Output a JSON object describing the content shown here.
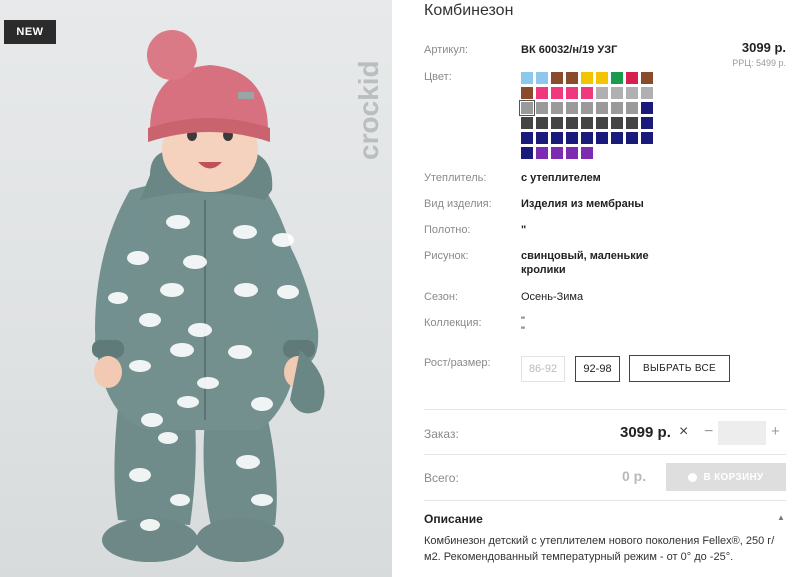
{
  "badge": "NEW",
  "brand": "crockid",
  "product": {
    "title": "Комбинезон",
    "article_label": "Артикул:",
    "article_value": "ВК 60032/н/19 УЗГ",
    "price": "3099 р.",
    "rrc": "РРЦ: 5499 р.",
    "color_label": "Цвет:",
    "colors": [
      "#8dc7ee",
      "#8dc7ee",
      "#8a4a2c",
      "#8a4a2c",
      "#f2c500",
      "#f2c500",
      "#1a9a4b",
      "#d6204f",
      "#8a4a2c",
      "#8a4a2c",
      "#f0397d",
      "#f0397d",
      "#f0397d",
      "#f0397d",
      "#b0b0b0",
      "#b0b0b0",
      "#b0b0b0",
      "#b0b0b0",
      "#9a9a9a",
      "#9a9a9a",
      "#9a9a9a",
      "#9a9a9a",
      "#9a9a9a",
      "#9a9a9a",
      "#9a9a9a",
      "#9a9a9a",
      "#1a1a7a",
      "#444444",
      "#444444",
      "#444444",
      "#444444",
      "#444444",
      "#444444",
      "#444444",
      "#444444",
      "#1a1a7a",
      "#1a1a7a",
      "#1a1a7a",
      "#1a1a7a",
      "#1a1a7a",
      "#1a1a7a",
      "#1a1a7a",
      "#1a1a7a",
      "#1a1a7a",
      "#1a1a7a",
      "#1a1a7a",
      "#7d2cb2",
      "#7d2cb2",
      "#7d2cb2",
      "#7d2cb2"
    ],
    "selected_color_index": 18,
    "insulation_label": "Утеплитель:",
    "insulation_value": "с утеплителем",
    "type_label": "Вид изделия:",
    "type_value": "Изделия из мембраны",
    "fabric_label": "Полотно:",
    "fabric_value": "\"",
    "pattern_label": "Рисунок:",
    "pattern_value_line1": "свинцовый, маленькие",
    "pattern_value_line2": "кролики",
    "season_label": "Сезон:",
    "season_value": "Осень-Зима",
    "collection_label": "Коллекция:",
    "collection_value_line1": "\"",
    "collection_value_line2": "\"",
    "size_label": "Рост/размер:",
    "sizes": [
      "86-92",
      "92-98"
    ],
    "select_all": "ВЫБРАТЬ ВСЕ"
  },
  "order": {
    "label": "Заказ:",
    "price": "3099 р.",
    "quantity": ""
  },
  "total": {
    "label": "Всего:",
    "value": "0 р.",
    "cart_button": "В КОРЗИНУ"
  },
  "description": {
    "title": "Описание",
    "text": "Комбинезон детский с утеплителем нового поколения Fellex®, 250 г/м2. Рекомендованный температурный режим - от 0° до -25°."
  }
}
